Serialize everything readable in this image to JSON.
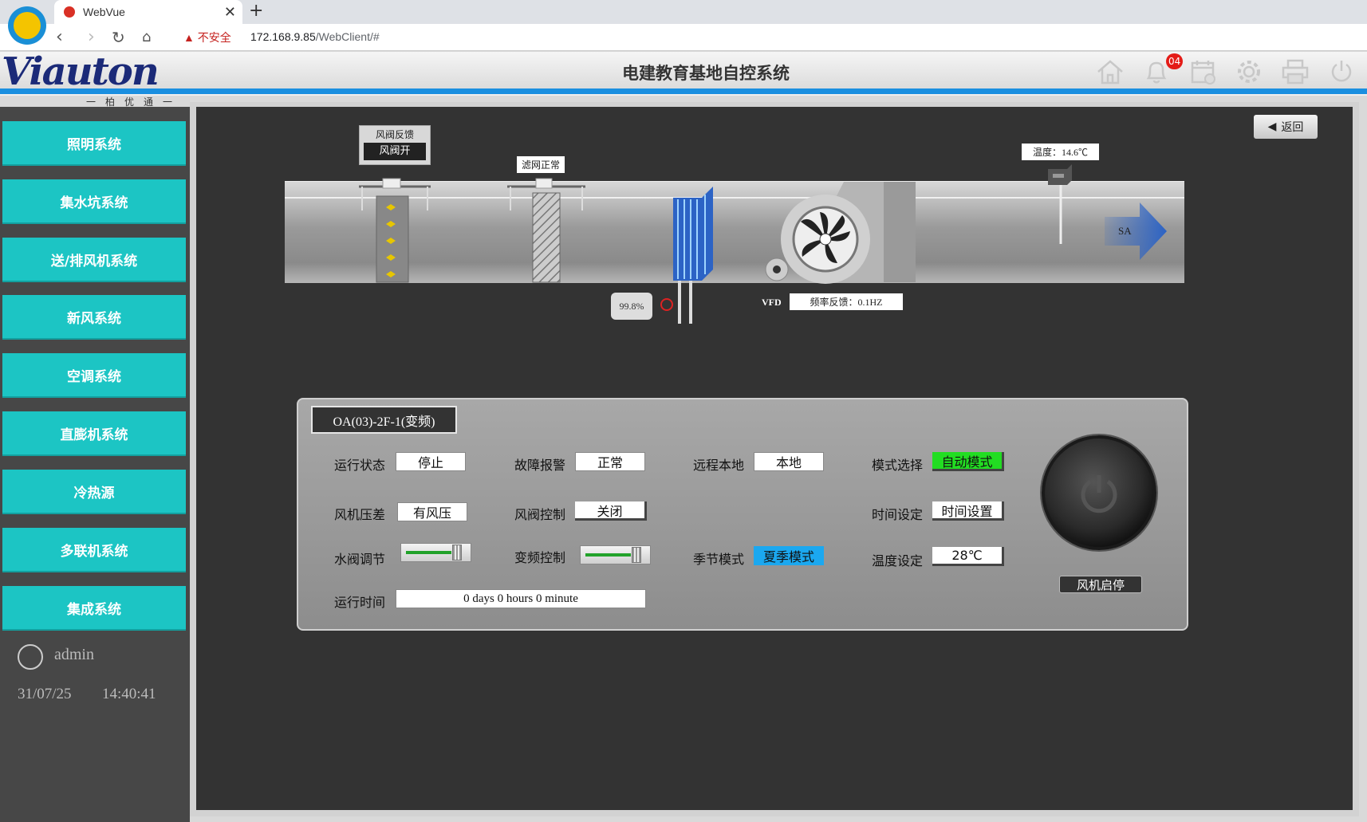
{
  "browser": {
    "tab_title": "WebVue",
    "url_warning": "不安全",
    "url_host": "172.168.9.85",
    "url_path": "/WebClient/#"
  },
  "header": {
    "brand": "Viauton",
    "brand_sub": "一柏优通一",
    "title": "电建教育基地自控系统",
    "notification_count": "04",
    "icons": [
      "home-icon",
      "bell-icon",
      "calendar-icon",
      "gear-icon",
      "printer-icon",
      "power-icon"
    ]
  },
  "sidebar": {
    "items": [
      {
        "label": "照明系统"
      },
      {
        "label": "集水坑系统"
      },
      {
        "label": "送/排风机系统"
      },
      {
        "label": "新风系统"
      },
      {
        "label": "空调系统"
      },
      {
        "label": "直膨机系统"
      },
      {
        "label": "冷热源"
      },
      {
        "label": "多联机系统"
      },
      {
        "label": "集成系统"
      }
    ],
    "user": "admin",
    "date": "31/07/25",
    "time": "14:40:41"
  },
  "diagram": {
    "back_label": "返回",
    "damper_feedback_title": "风阀反馈",
    "damper_feedback_value": "风阀开",
    "filter_status": "滤网正常",
    "temperature": "温度：14.6℃",
    "sa_label": "SA",
    "valve_percent": "99.8%",
    "vfd_label": "VFD",
    "freq_feedback": "频率反馈：0.1HZ"
  },
  "panel": {
    "title": "OA(03)-2F-1(变频)",
    "run_status_label": "运行状态",
    "run_status_value": "停止",
    "fault_label": "故障报警",
    "fault_value": "正常",
    "remote_label": "远程本地",
    "remote_value": "本地",
    "mode_label": "模式选择",
    "mode_value": "自动模式",
    "pressure_label": "风机压差",
    "pressure_value": "有风压",
    "damper_ctrl_label": "风阀控制",
    "damper_ctrl_value": "关闭",
    "time_set_label": "时间设定",
    "time_set_value": "时间设置",
    "water_valve_label": "水阀调节",
    "vfd_ctrl_label": "变频控制",
    "season_label": "季节模式",
    "season_value": "夏季模式",
    "temp_set_label": "温度设定",
    "temp_set_value": "28℃",
    "runtime_label": "运行时间",
    "runtime_value": "0 days 0 hours 0 minute",
    "power_label": "风机启停",
    "water_valve_level": 0.9,
    "vfd_level": 0.9
  },
  "colors": {
    "sidebar_button": "#1cc5c4",
    "header_stripe": "#1a8fe0",
    "mode_active": "#22dd22",
    "season_active": "#1ba8f0"
  }
}
